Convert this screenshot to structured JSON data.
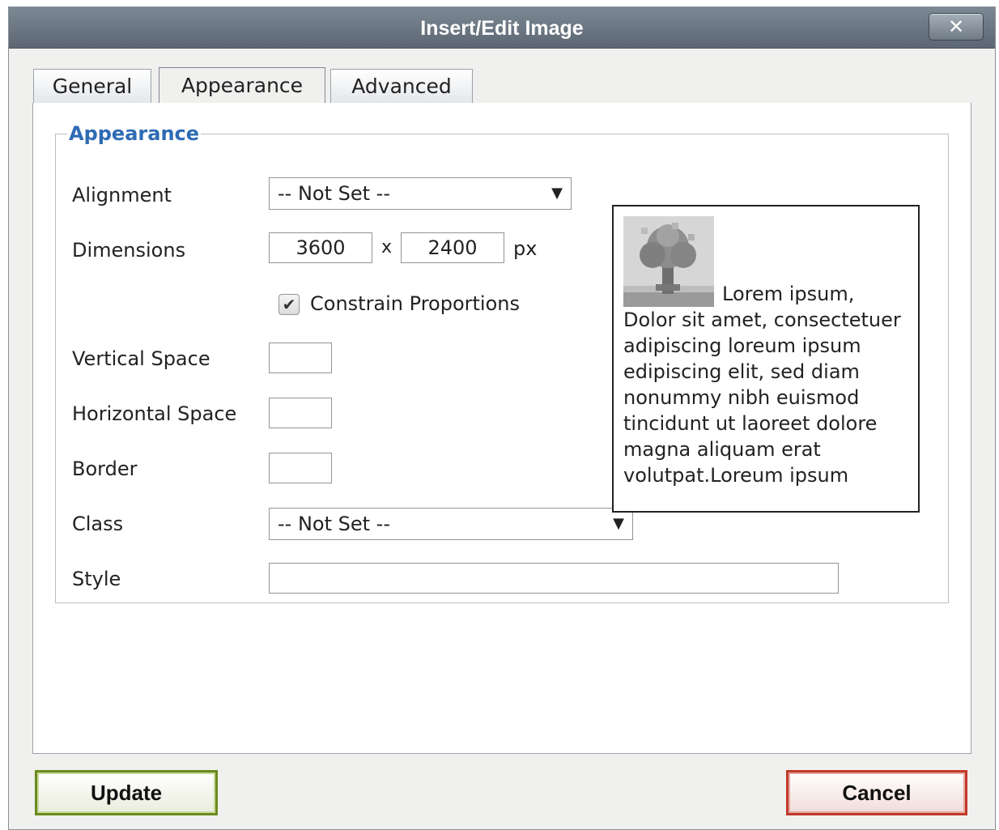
{
  "dialog": {
    "title": "Insert/Edit Image",
    "close_label": "✕"
  },
  "tabs": [
    {
      "label": "General"
    },
    {
      "label": "Appearance"
    },
    {
      "label": "Advanced"
    }
  ],
  "active_tab": "Appearance",
  "fieldset": {
    "legend": "Appearance"
  },
  "form": {
    "alignment_label": "Alignment",
    "alignment_value": "-- Not Set --",
    "dimensions_label": "Dimensions",
    "width_value": "3600",
    "height_value": "2400",
    "x_label": "x",
    "px_label": "px",
    "constrain_label": "Constrain Proportions",
    "constrain_checked": true,
    "vspace_label": "Vertical Space",
    "vspace_value": "",
    "hspace_label": "Horizontal Space",
    "hspace_value": "",
    "border_label": "Border",
    "border_value": "",
    "class_label": "Class",
    "class_value": "-- Not Set --",
    "style_label": "Style",
    "style_value": ""
  },
  "preview": {
    "text": "Lorem ipsum, Dolor sit amet, consectetuer adipiscing loreum ipsum edipiscing elit, sed diam nonummy nibh euismod tincidunt ut laoreet dolore magna aliquam erat volutpat.Loreum ipsum"
  },
  "buttons": {
    "update_label": "Update",
    "cancel_label": "Cancel"
  },
  "colors": {
    "titlebar": "#6a7580",
    "legend": "#2d6bb3",
    "update_border": "#6a8a1c",
    "cancel_border": "#c0392b"
  }
}
